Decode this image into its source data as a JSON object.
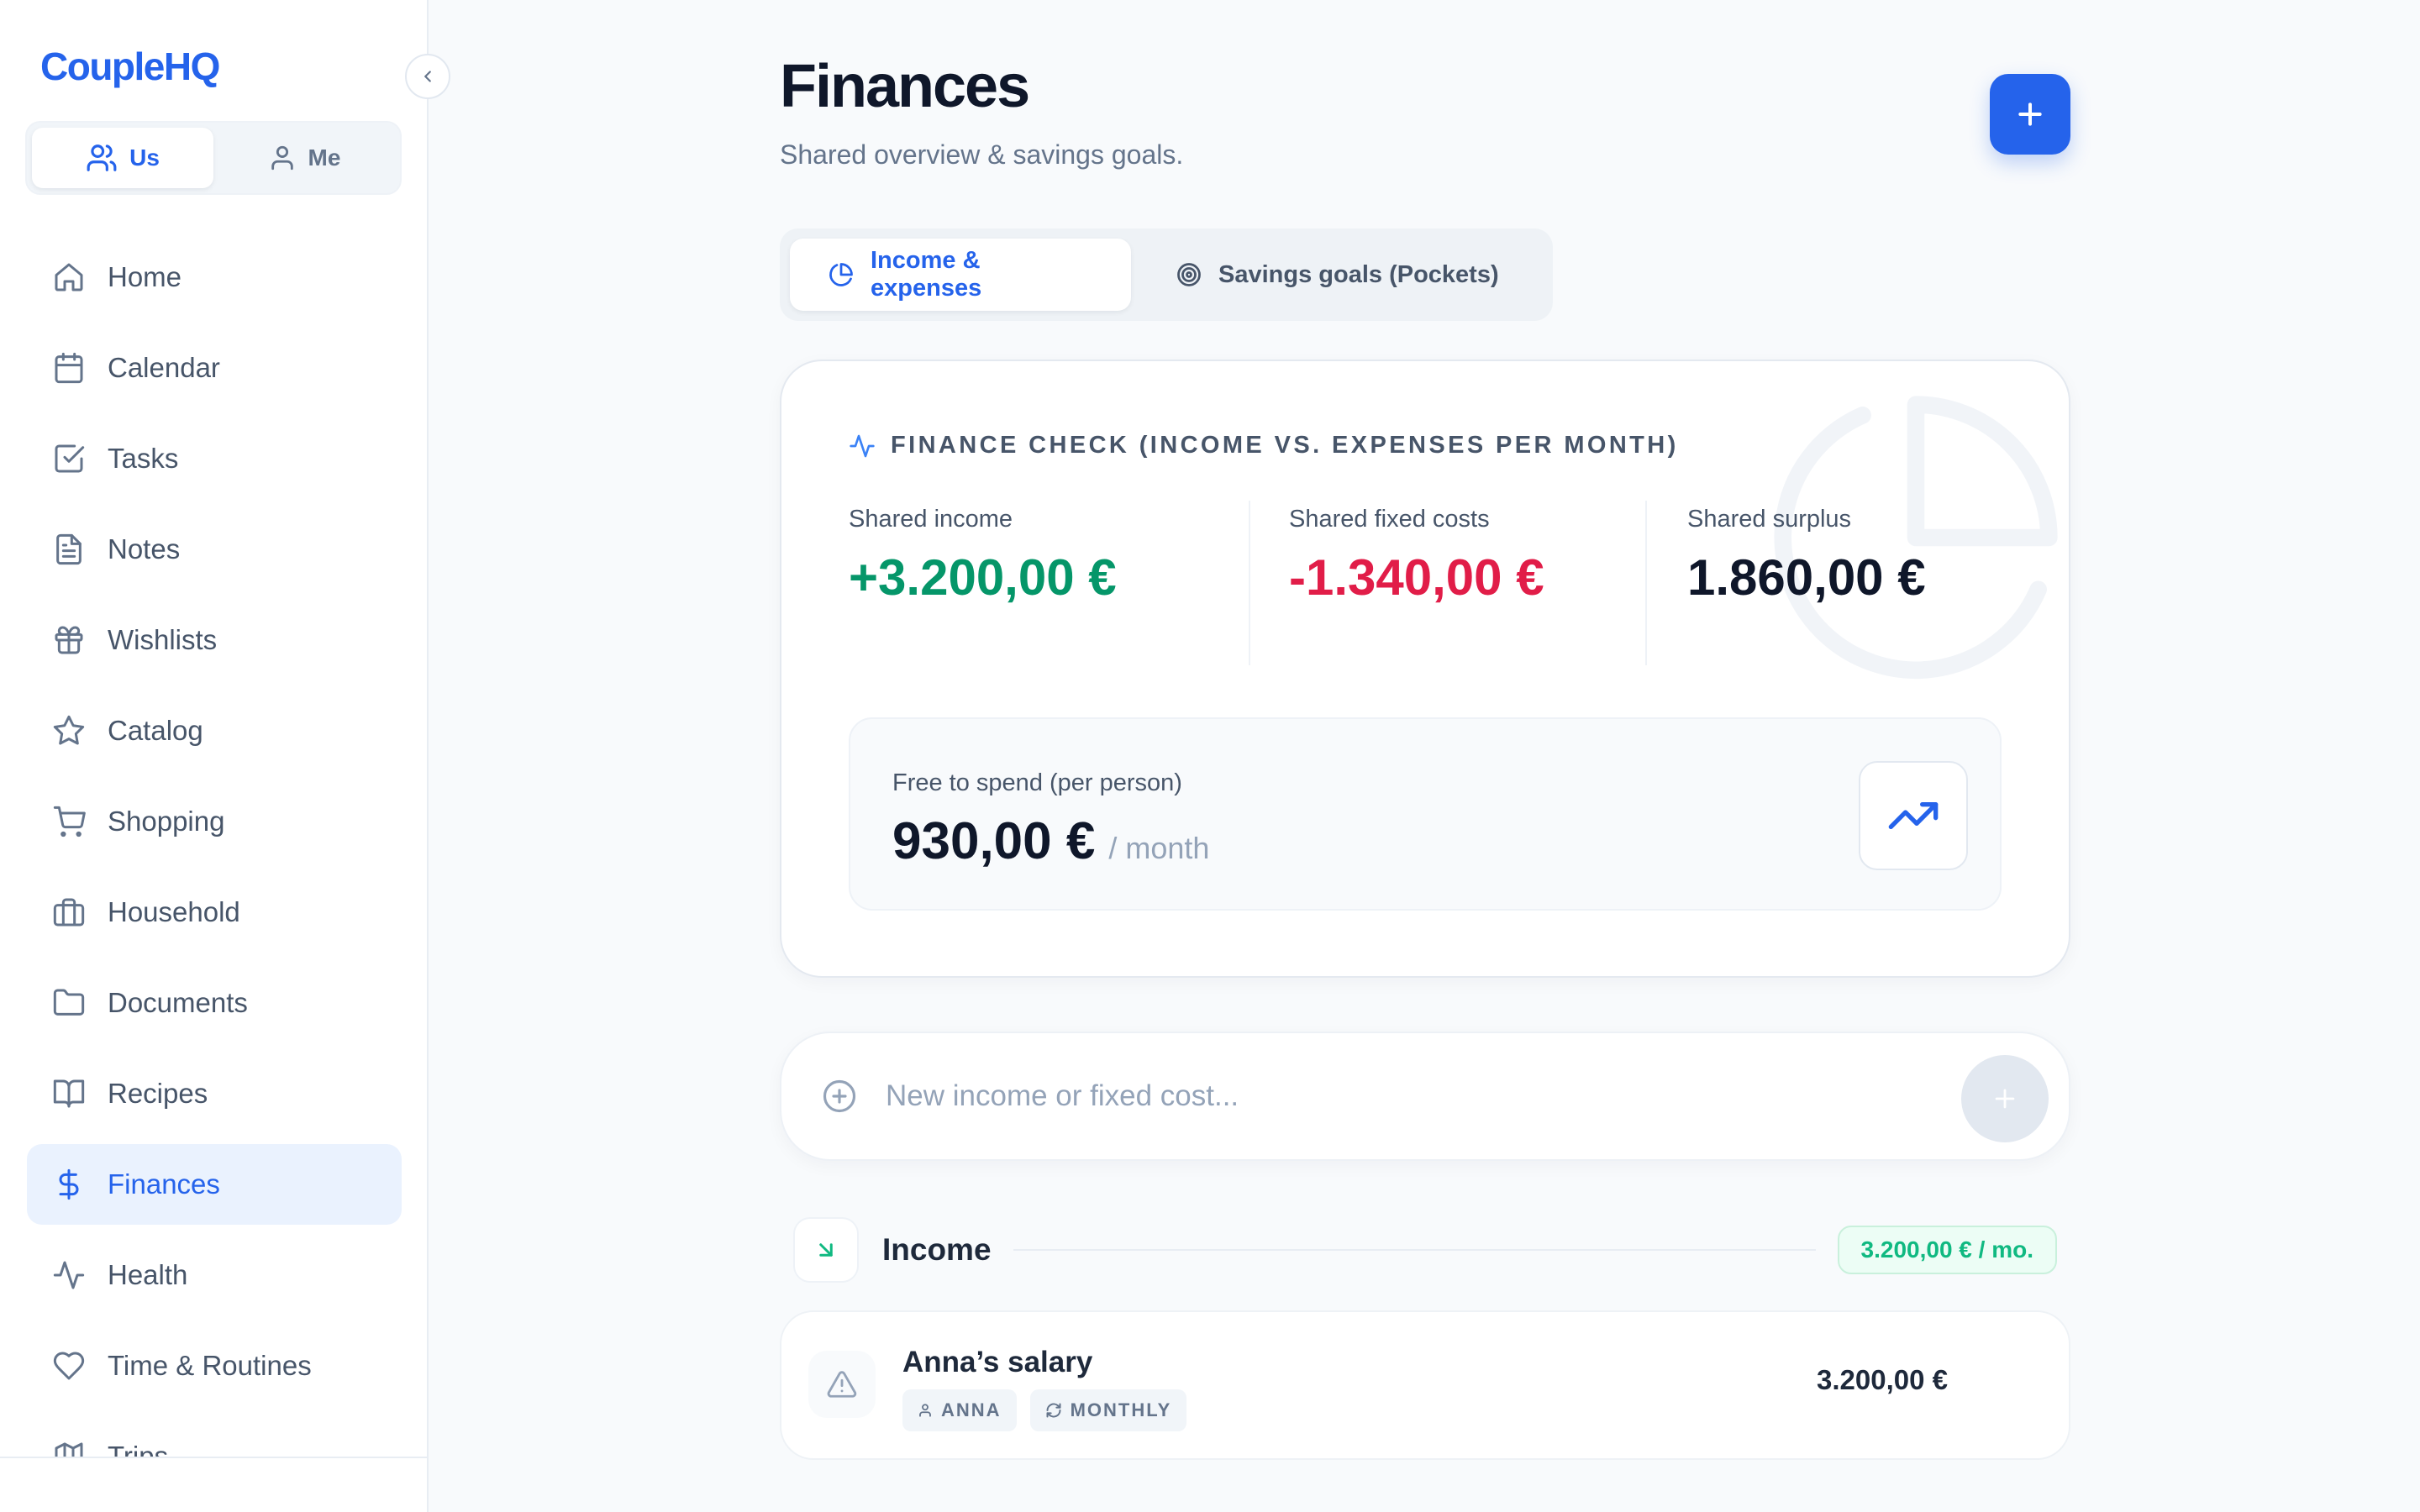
{
  "app": {
    "name": "CoupleHQ"
  },
  "mode_switch": {
    "us": "Us",
    "me": "Me"
  },
  "sidebar": {
    "items": [
      {
        "label": "Home",
        "icon": "home-icon"
      },
      {
        "label": "Calendar",
        "icon": "calendar-icon"
      },
      {
        "label": "Tasks",
        "icon": "check-square-icon"
      },
      {
        "label": "Notes",
        "icon": "file-text-icon"
      },
      {
        "label": "Wishlists",
        "icon": "gift-icon"
      },
      {
        "label": "Catalog",
        "icon": "star-icon"
      },
      {
        "label": "Shopping",
        "icon": "cart-icon"
      },
      {
        "label": "Household",
        "icon": "briefcase-icon"
      },
      {
        "label": "Documents",
        "icon": "folder-icon"
      },
      {
        "label": "Recipes",
        "icon": "book-icon"
      },
      {
        "label": "Finances",
        "icon": "dollar-icon",
        "active": true
      },
      {
        "label": "Health",
        "icon": "activity-icon"
      },
      {
        "label": "Time & Routines",
        "icon": "heart-icon"
      },
      {
        "label": "Trips",
        "icon": "map-icon"
      }
    ]
  },
  "header": {
    "title": "Finances",
    "subtitle": "Shared overview & savings goals."
  },
  "tabs": [
    {
      "label": "Income & expenses",
      "icon": "pie-chart-icon",
      "active": true
    },
    {
      "label": "Savings goals (Pockets)",
      "icon": "target-icon"
    }
  ],
  "finance_check": {
    "label": "FINANCE CHECK (INCOME VS. EXPENSES PER MONTH)",
    "income": {
      "label": "Shared income",
      "value": "+3.200,00 €"
    },
    "fixed_costs": {
      "label": "Shared fixed costs",
      "value": "-1.340,00 €"
    },
    "surplus": {
      "label": "Shared surplus",
      "value": "1.860,00 €"
    },
    "free_to_spend": {
      "label": "Free to spend (per person)",
      "value": "930,00 €",
      "unit": "/ month"
    }
  },
  "quick_add": {
    "placeholder": "New income or fixed cost..."
  },
  "income_section": {
    "title": "Income",
    "total": "3.200,00 € / mo.",
    "items": [
      {
        "title": "Anna’s salary",
        "person": "ANNA",
        "frequency": "MONTHLY",
        "amount": "3.200,00 €"
      }
    ]
  },
  "colors": {
    "accent": "#2563eb",
    "positive": "#059669",
    "negative": "#e11d48",
    "text": "#0f172a"
  }
}
